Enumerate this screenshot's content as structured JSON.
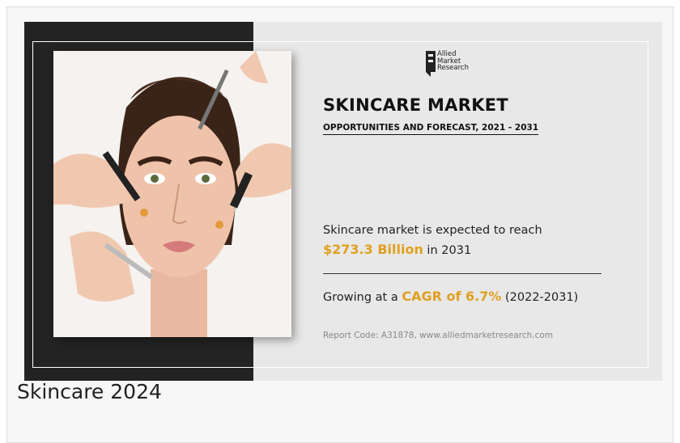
{
  "banner": {
    "logo": {
      "name": "allied-market-research-logo",
      "text": "Allied\nMarket\nResearch"
    },
    "title": "SKINCARE MARKET",
    "subtitle": "OPPORTUNITIES AND FORECAST, 2021 - 2031",
    "reach": {
      "prefix": "Skincare market is expected to reach",
      "value": "$273.3 Billion",
      "suffix": " in 2031"
    },
    "cagr": {
      "prefix": "Growing at a ",
      "value": "CAGR of 6.7%",
      "suffix": " (2022-2031)"
    },
    "report_code": "Report Code: A31878, www.alliedmarketresearch.com",
    "accent_color": "#e0a020"
  },
  "caption": "Skincare 2024"
}
